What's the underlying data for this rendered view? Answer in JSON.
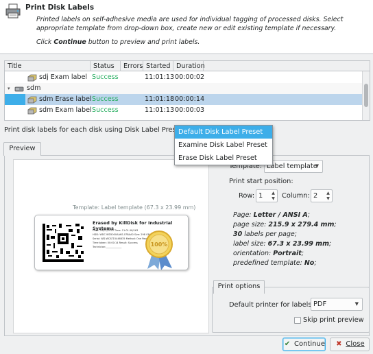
{
  "header": {
    "title": "Print Disk Labels",
    "description": "Printed labels on self-adhesive media are used for individual tagging of processed disks. Select appropriate template from drop-down box, create new or edit existing template if necessary.",
    "click_prefix": "Click ",
    "click_bold": "Continue",
    "click_suffix": " button to preview and print labels.",
    "icon": "printer-icon"
  },
  "table": {
    "columns": [
      "Title",
      "Status",
      "Errors",
      "Started",
      "Duration"
    ],
    "rows": [
      {
        "title": "sdj Exam label",
        "status": "Success",
        "errors": "",
        "started": "11:01:13",
        "duration": "00:00:02"
      },
      {
        "title": "sdm",
        "status": "",
        "errors": "",
        "started": "",
        "duration": ""
      },
      {
        "title": "sdm Erase label",
        "status": "Success",
        "errors": "",
        "started": "11:01:18",
        "duration": "00:00:14"
      },
      {
        "title": "sdm Exam label",
        "status": "Success",
        "errors": "",
        "started": "11:01:13",
        "duration": "00:00:03"
      }
    ]
  },
  "preset": {
    "label": "Print disk labels for each disk using Disk Label Preset:",
    "options": [
      "Default Disk Label Preset",
      "Examine Disk Label Preset",
      "Erase Disk Label Preset"
    ],
    "highlighted": "Default Disk Label Preset"
  },
  "preview": {
    "tab_label": "Preview",
    "template_caption": "Template: Label template (67.3 x 23.99 mm)",
    "label": {
      "title": "Erased by KillDisk for Industrial Systems",
      "lines": [
        "Date: 04/02/2020 Time: 11:01:18/163",
        "HDD: WDC WD5000AAKS-07BAA0  Size: 298 GB",
        "Serial: WD-WCAT15446835  Method: One Pass Zeros",
        "Time taken: 00:00:14  Result: Success",
        "Technician:_____________"
      ],
      "seal_text": "100%"
    }
  },
  "settings": {
    "template_label": "Template:",
    "template_value": "Label template",
    "print_start_label": "Print start position:",
    "row_label": "Row:",
    "row_value": "1",
    "column_label": "Column:",
    "column_value": "2",
    "specs": [
      {
        "prefix": "Page: ",
        "value": "Letter / ANSI A",
        "suffix": ";"
      },
      {
        "prefix": "page size: ",
        "value": "215.9 x 279.4 mm",
        "suffix": ";"
      },
      {
        "prefix": "",
        "value": "30",
        "suffix": " labels per page;"
      },
      {
        "prefix": "label size: ",
        "value": "67.3 x 23.99 mm",
        "suffix": ";"
      },
      {
        "prefix": "orientation: ",
        "value": "Portrait",
        "suffix": ";"
      },
      {
        "prefix": "predefined template: ",
        "value": "No",
        "suffix": ";"
      }
    ]
  },
  "print_options": {
    "tab_label": "Print options",
    "printer_label": "Default printer for labels:",
    "printer_value": "PDF",
    "skip_preview_label": "Skip print preview",
    "skip_preview_checked": false
  },
  "buttons": {
    "continue_label": "Continue",
    "close_label": "Close"
  },
  "colors": {
    "accent": "#3daee9",
    "success": "#27ae60"
  }
}
